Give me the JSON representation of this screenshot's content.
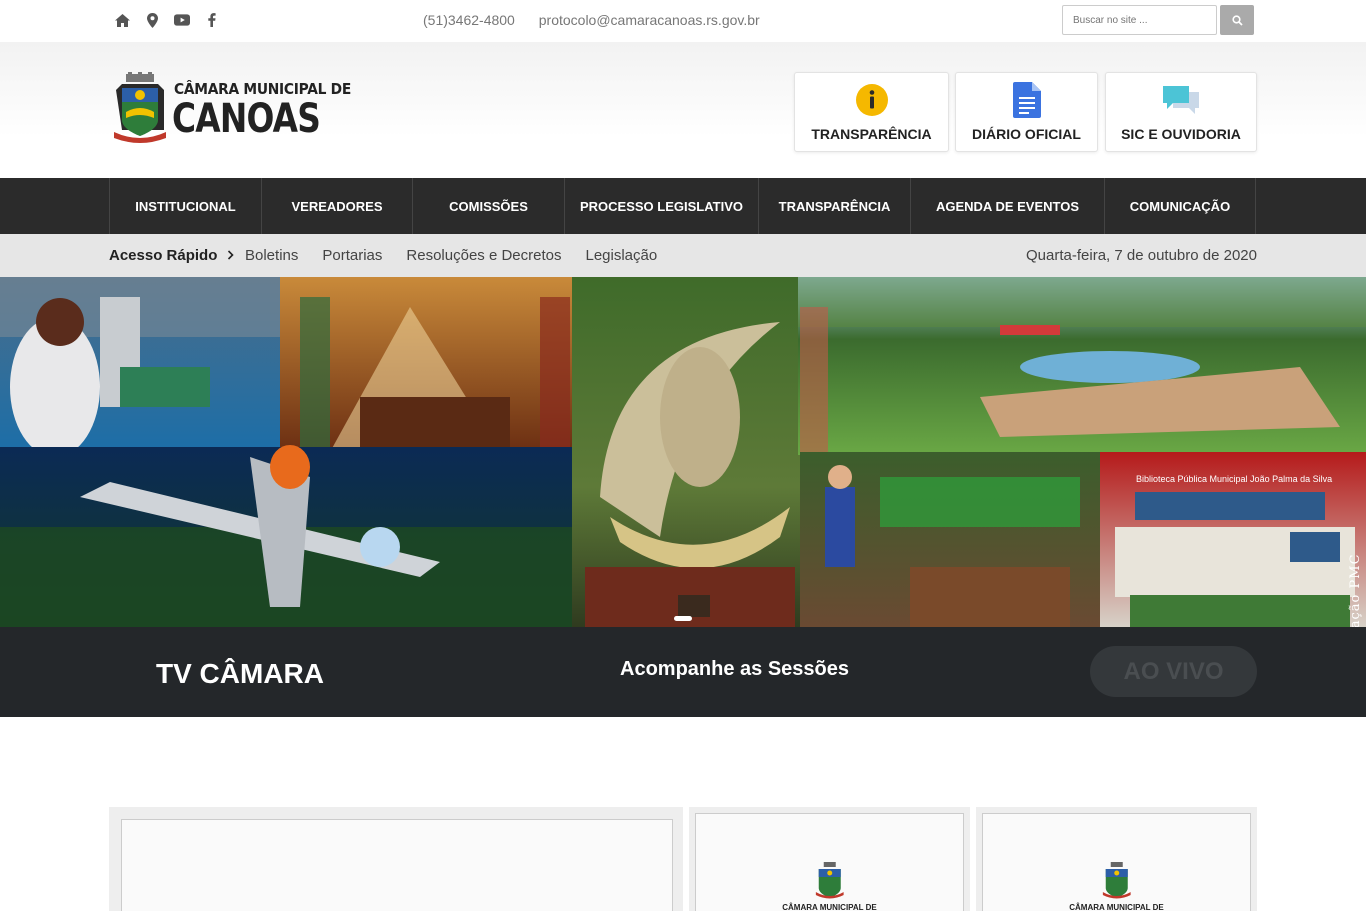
{
  "topbar": {
    "icons": [
      "home-icon",
      "map-pin-icon",
      "youtube-icon",
      "facebook-icon"
    ],
    "phone": "(51)3462-4800",
    "email": "protocolo@camaracanoas.rs.gov.br",
    "search_placeholder": "Buscar no site ..."
  },
  "header": {
    "logo_line1": "CÂMARA MUNICIPAL DE",
    "logo_line2": "CANOAS",
    "quick_links": [
      {
        "label": "TRANSPARÊNCIA",
        "icon": "info-icon"
      },
      {
        "label": "DIÁRIO OFICIAL",
        "icon": "document-icon"
      },
      {
        "label": "SIC E OUVIDORIA",
        "icon": "chat-bubbles-icon"
      }
    ]
  },
  "nav": {
    "items": [
      "INSTITUCIONAL",
      "VEREADORES",
      "COMISSÕES",
      "PROCESSO LEGISLATIVO",
      "TRANSPARÊNCIA",
      "AGENDA DE EVENTOS",
      "COMUNICAÇÃO"
    ]
  },
  "subbar": {
    "quick_label": "Acesso Rápido",
    "links": [
      "Boletins",
      "Portarias",
      "Resoluções e Decretos",
      "Legislação"
    ],
    "date": "Quarta-feira, 7 de outubro de 2020"
  },
  "banner": {
    "credit": "Divulgação PMC",
    "library_sign": "Biblioteca Pública Municipal João Palma da Silva"
  },
  "tv": {
    "title": "TV CÂMARA",
    "subtitle": "Acompanhe as Sessões",
    "live_button": "AO VIVO"
  },
  "cards": {
    "logo_text": "CÂMARA MUNICIPAL DE"
  },
  "colors": {
    "nav_bg": "#2b2b2b",
    "tv_bg": "#24272a",
    "info_yellow": "#f5b800",
    "doc_blue": "#3b73e0",
    "chat_cyan": "#4cc4d6"
  }
}
